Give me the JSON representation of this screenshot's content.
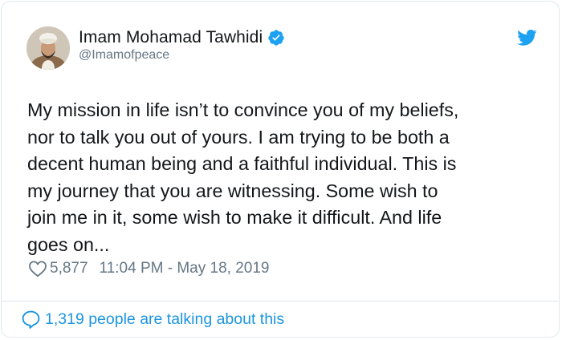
{
  "tweet": {
    "display_name": "Imam Mohamad Tawhidi",
    "handle": "@Imamofpeace",
    "text": "My mission in life isn’t to convince you of my beliefs,\nnor to talk you out of yours. I am trying to be both a\ndecent human being and a faithful individual. This is\nmy journey that you are witnessing. Some wish to\njoin me in it, some wish to make it difficult. And life\ngoes on...",
    "likes": "5,877",
    "timestamp": "11:04 PM - May 18, 2019",
    "talking": "1,319 people are talking about this"
  },
  "icons": {
    "verified": "verified-badge-icon",
    "brand": "twitter-bird-icon",
    "like": "heart-icon",
    "reply": "speech-bubble-icon"
  },
  "colors": {
    "brand": "#1da1f2",
    "link": "#1b95e0",
    "text": "#14171a",
    "muted": "#657786",
    "border": "#e1e8ed"
  }
}
